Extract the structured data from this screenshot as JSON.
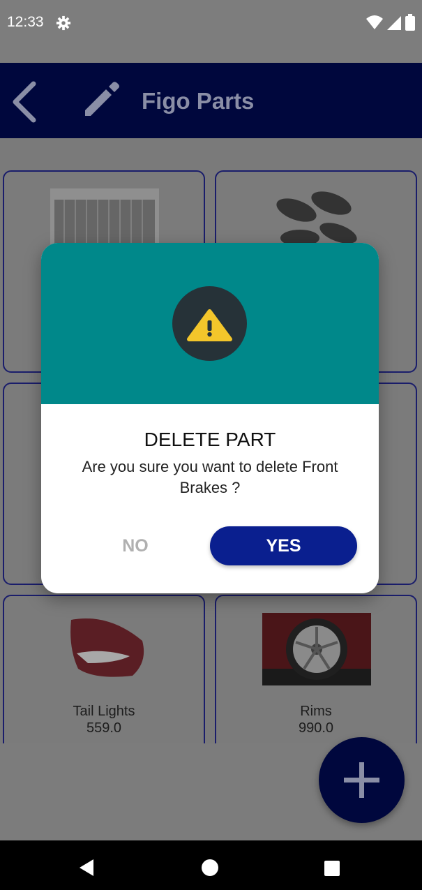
{
  "status_bar": {
    "time": "12:33",
    "icons": [
      "gear-icon",
      "wifi-icon",
      "signal-icon",
      "battery-icon"
    ]
  },
  "app_bar": {
    "title": "Figo Parts",
    "back_icon": "back-arrow-icon",
    "edit_icon": "pencil-icon",
    "background": "#00073d"
  },
  "parts": [
    {
      "name": "",
      "price": "",
      "image": "radiator"
    },
    {
      "name": "",
      "price": "",
      "image": "brake-pads"
    },
    {
      "name": "",
      "price": "",
      "image": "part"
    },
    {
      "name": "",
      "price": "",
      "image": "part"
    },
    {
      "name": "Tail Lights",
      "price": "559.0",
      "image": "tail-light"
    },
    {
      "name": "Rims",
      "price": "990.0",
      "image": "rim"
    }
  ],
  "dialog": {
    "icon": "warning-icon",
    "title": "DELETE PART",
    "message": "Are you sure you want to delete Front Brakes ?",
    "no_label": "NO",
    "yes_label": "YES",
    "header_color": "#00888a",
    "yes_color": "#0a1f8f"
  },
  "fab": {
    "icon": "plus-icon"
  },
  "nav_bar": {
    "icons": [
      "nav-back-icon",
      "nav-home-icon",
      "nav-recents-icon"
    ]
  }
}
